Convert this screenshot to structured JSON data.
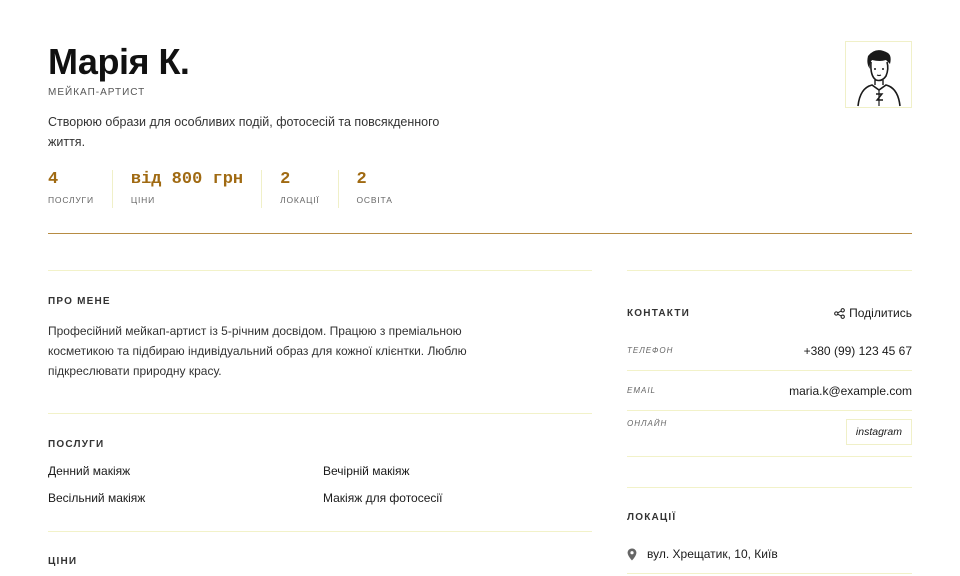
{
  "profile": {
    "name": "Марія К.",
    "role": "МЕЙКАП-АРТИСТ",
    "tagline": "Створюю образи для особливих подій, фотосесій та повсякденного життя."
  },
  "stats": [
    {
      "value": "4",
      "label": "ПОСЛУГИ"
    },
    {
      "value": "від 800 грн",
      "label": "ЦІНИ"
    },
    {
      "value": "2",
      "label": "ЛОКАЦІЇ"
    },
    {
      "value": "2",
      "label": "ОСВІТА"
    }
  ],
  "about": {
    "title": "ПРО МЕНЕ",
    "text": "Професійний мейкап-артист із 5-річним досвідом. Працюю з преміальною косметикою та підбираю індивідуальний образ для кожної клієнтки. Люблю підкреслювати природну красу."
  },
  "services": {
    "title": "ПОСЛУГИ",
    "items": [
      "Денний макіяж",
      "Вечірній макіяж",
      "Весільний макіяж",
      "Макіяж для фотосесії"
    ]
  },
  "prices": {
    "title": "ЦІНИ"
  },
  "contacts": {
    "title": "КОНТАКТИ",
    "share_label": "Поділитись",
    "phone_label": "ТЕЛЕФОН",
    "phone": "+380 (99) 123 45 67",
    "email_label": "EMAIL",
    "email": "maria.k@example.com",
    "online_label": "ОНЛАЙН",
    "instagram_label": "instagram"
  },
  "locations": {
    "title": "ЛОКАЦІЇ",
    "items": [
      "вул. Хрещатик, 10, Київ"
    ]
  },
  "colors": {
    "accent": "#a06a12",
    "divider": "#b78c43",
    "soft_line": "#f2f2c9"
  }
}
